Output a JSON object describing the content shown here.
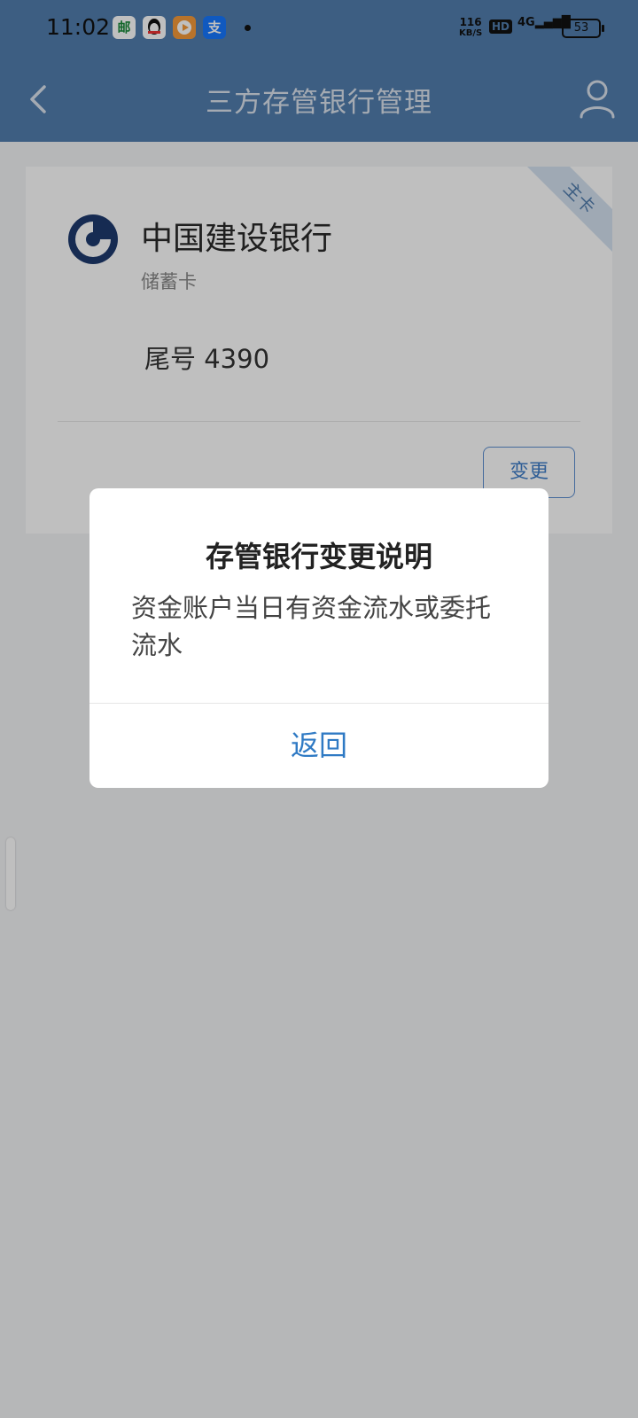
{
  "status_bar": {
    "time": "11:02",
    "net_speed_value": "116",
    "net_speed_unit": "KB/S",
    "hd_label": "HD",
    "signal_label": "4G",
    "battery": "53",
    "notification_icons": [
      "postal-bank-icon",
      "qq-icon",
      "video-app-icon",
      "alipay-icon"
    ]
  },
  "header": {
    "title": "三方存管银行管理"
  },
  "card": {
    "badge": "主卡",
    "bank_name": "中国建设银行",
    "card_type": "储蓄卡",
    "tail_number": "尾号 4390",
    "change_button": "变更"
  },
  "dialog": {
    "title": "存管银行变更说明",
    "message": "资金账户当日有资金流水或委托流水",
    "button": "返回"
  },
  "colors": {
    "header_blue": "#527eae",
    "accent_blue": "#2f7ac4",
    "dim_overlay": "rgba(0,0,0,0.25)"
  }
}
